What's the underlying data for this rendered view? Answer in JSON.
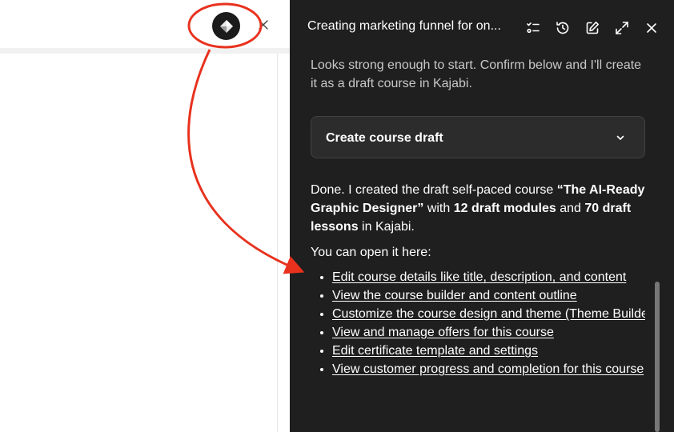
{
  "panel": {
    "title": "Creating marketing funnel for on...",
    "intro_text": "Looks strong enough to start. Confirm below and I'll create it as a draft course in Kajabi.",
    "accordion_label": "Create course draft",
    "done_prefix": "Done. I created the draft self-paced course ",
    "course_name": "“The AI-Ready Graphic Designer”",
    "done_mid1": " with ",
    "modules_text": "12 draft modules",
    "done_mid2": " and ",
    "lessons_text": "70 draft lessons",
    "done_suffix": " in Kajabi.",
    "open_text": "You can open it here:",
    "links": [
      "Edit course details like title, description, and content",
      "View the course builder and content outline",
      "Customize the course design and theme (Theme Builder)",
      "View and manage offers for this course",
      "Edit certificate template and settings",
      "View customer progress and completion for this course"
    ]
  },
  "icons": {
    "logo": "diamond-logo-icon",
    "left_close": "close-icon",
    "header": [
      "task-list-icon",
      "history-icon",
      "edit-icon",
      "expand-icon",
      "close-icon"
    ],
    "accordion": "chevron-down-icon"
  },
  "colors": {
    "panel_bg": "#1f1f1f",
    "annotation_red": "#e8321e"
  }
}
